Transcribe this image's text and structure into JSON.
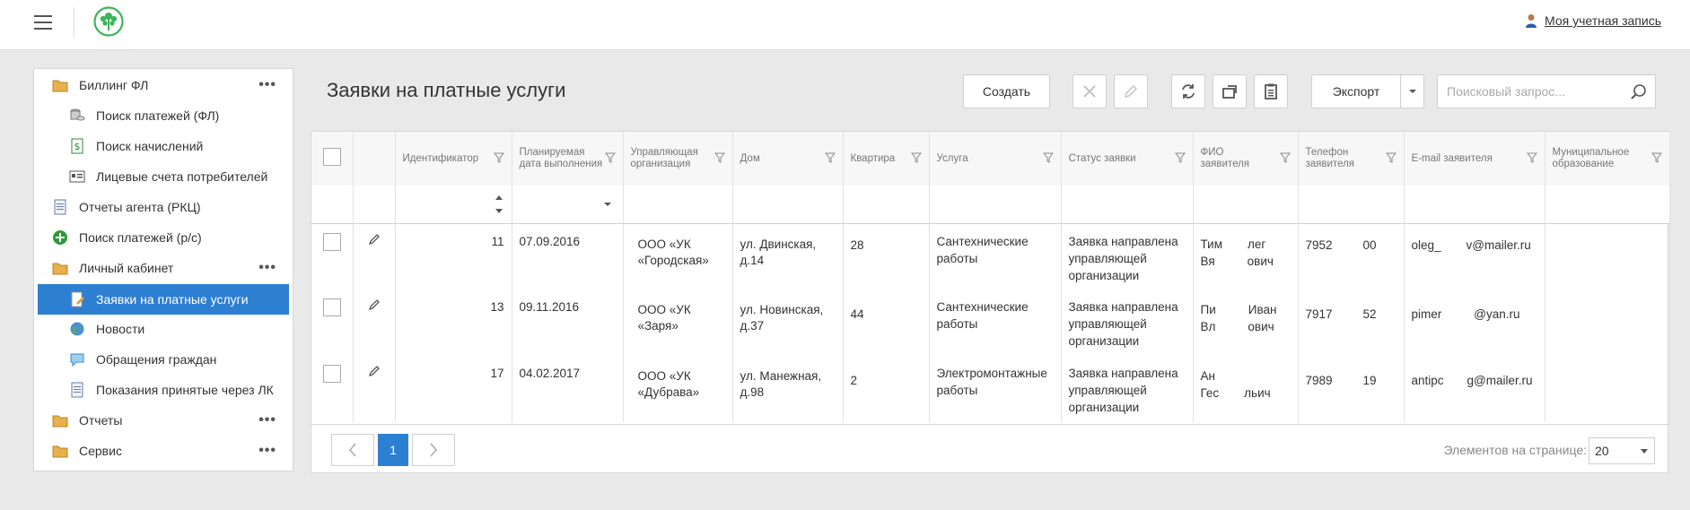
{
  "header": {
    "account_label": "Моя учетная запись"
  },
  "sidebar": {
    "items": [
      {
        "label": "Биллинг ФЛ",
        "icon": "folder-icon",
        "more": "•••"
      },
      {
        "label": "Поиск платежей (ФЛ)",
        "icon": "coins-icon"
      },
      {
        "label": "Поиск начислений",
        "icon": "money-doc-icon"
      },
      {
        "label": "Лицевые счета потребителей",
        "icon": "id-card-icon"
      },
      {
        "label": "Отчеты агента (РКЦ)",
        "icon": "document-icon"
      },
      {
        "label": "Поиск платежей (р/с)",
        "icon": "plus-circle-icon"
      },
      {
        "label": "Личный кабинет",
        "icon": "folder-icon",
        "more": "•••"
      },
      {
        "label": "Заявки на платные услуги",
        "icon": "edit-doc-icon"
      },
      {
        "label": "Новости",
        "icon": "globe-icon"
      },
      {
        "label": "Обращения граждан",
        "icon": "speech-bubble-icon"
      },
      {
        "label": "Показания принятые через ЛК",
        "icon": "document-icon"
      },
      {
        "label": "Отчеты",
        "icon": "folder-icon",
        "more": "•••"
      },
      {
        "label": "Сервис",
        "icon": "folder-icon",
        "more": "•••"
      }
    ]
  },
  "main": {
    "title": "Заявки на платные услуги",
    "create_label": "Создать",
    "export_label": "Экспорт",
    "search_placeholder": "Поисковый запрос..."
  },
  "table": {
    "columns": [
      "Идентификатор",
      "Планируемая дата выполнения",
      "Управляющая организация",
      "Дом",
      "Квартира",
      "Услуга",
      "Статус заявки",
      "ФИО заявителя",
      "Телефон заявителя",
      "E-mail заявителя",
      "Муниципальное образование"
    ],
    "rows": [
      {
        "id": "11",
        "date": "07.09.2016",
        "org": "ООО «УК «Городская»",
        "house": "ул. Двинская, д.14",
        "flat": "28",
        "service": "Сантехнические работы",
        "status": "Заявка направлена управляющей организации",
        "fio_a": "Тим",
        "fio_b": "лег",
        "fio_c": "Вя",
        "fio_d": "ович",
        "phone_a": "7952",
        "phone_b": "00",
        "email_a": "oleg_",
        "email_b": "v@mailer.ru"
      },
      {
        "id": "13",
        "date": "09.11.2016",
        "org": "ООО «УК «Заря»",
        "house": "ул. Новинская, д.37",
        "flat": "44",
        "service": "Сантехнические работы",
        "status": "Заявка направлена управляющей организации",
        "fio_a": "Пи",
        "fio_b": "Иван",
        "fio_c": "Вл",
        "fio_d": "ович",
        "phone_a": "7917",
        "phone_b": "52",
        "email_a": "pimer",
        "email_b": "@yan.ru"
      },
      {
        "id": "17",
        "date": "04.02.2017",
        "org": "ООО «УК «Дубрава»",
        "house": "ул. Манежная, д.98",
        "flat": "2",
        "service": "Электромонтажные работы",
        "status": "Заявка направлена управляющей организации",
        "fio_a": "Ан",
        "fio_b": "",
        "fio_c": "Гес",
        "fio_d": "льич",
        "phone_a": "7989",
        "phone_b": "19",
        "email_a": "antipc",
        "email_b": "g@mailer.ru"
      }
    ]
  },
  "pager": {
    "current": "1",
    "per_page_label": "Элементов на странице:",
    "per_page": "20"
  },
  "colors": {
    "accent": "#2d7fd2",
    "logo": "#3bb558"
  }
}
